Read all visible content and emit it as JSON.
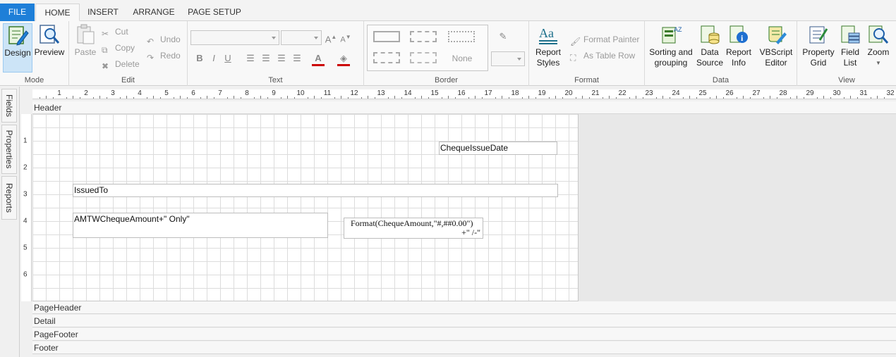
{
  "tabs": {
    "file": "FILE",
    "home": "HOME",
    "insert": "INSERT",
    "arrange": "ARRANGE",
    "page_setup": "PAGE SETUP"
  },
  "ribbon": {
    "mode": {
      "label": "Mode",
      "design": "Design",
      "preview": "Preview"
    },
    "edit": {
      "label": "Edit",
      "paste": "Paste",
      "cut": "Cut",
      "copy": "Copy",
      "delete": "Delete",
      "undo": "Undo",
      "redo": "Redo"
    },
    "text": {
      "label": "Text",
      "bold": "B",
      "italic": "I",
      "underline": "U"
    },
    "border": {
      "label": "Border",
      "none": "None"
    },
    "format": {
      "label": "Format",
      "report_styles": "Report Styles",
      "format_painter": "Format Painter",
      "as_table_row": "As Table Row"
    },
    "data": {
      "label": "Data",
      "sorting": "Sorting and grouping",
      "data_source": "Data Source",
      "report_info": "Report Info",
      "vbscript": "VBScript Editor"
    },
    "view": {
      "label": "View",
      "property_grid": "Property Grid",
      "field_list": "Field List",
      "zoom": "Zoom"
    }
  },
  "side_tabs": {
    "fields": "Fields",
    "properties": "Properties",
    "reports": "Reports"
  },
  "ruler": {
    "h_numbers": [
      "1",
      "2",
      "3",
      "4",
      "5",
      "6",
      "7",
      "8",
      "9",
      "10",
      "11",
      "12",
      "13",
      "14",
      "15",
      "16",
      "17",
      "18",
      "19",
      "20",
      "21",
      "22",
      "23",
      "24",
      "25",
      "26",
      "27",
      "28",
      "29",
      "30",
      "31",
      "32"
    ],
    "v_numbers": [
      "1",
      "2",
      "3",
      "4",
      "5",
      "6"
    ]
  },
  "bands": {
    "header": "Header",
    "page_header": "PageHeader",
    "detail": "Detail",
    "page_footer": "PageFooter",
    "footer": "Footer"
  },
  "fields": {
    "cheque_issue_date": "ChequeIssueDate",
    "issued_to": "IssuedTo",
    "amount_words": "AMTWChequeAmount+\" Only\"",
    "amount_format_line1": "Format(ChequeAmount,\"#,##0.00\")",
    "amount_format_line2": "+\" /-\""
  },
  "colors": {
    "file_tab": "#1e7fd8",
    "selected": "#cce4f7",
    "canvas": "#ffffff"
  }
}
